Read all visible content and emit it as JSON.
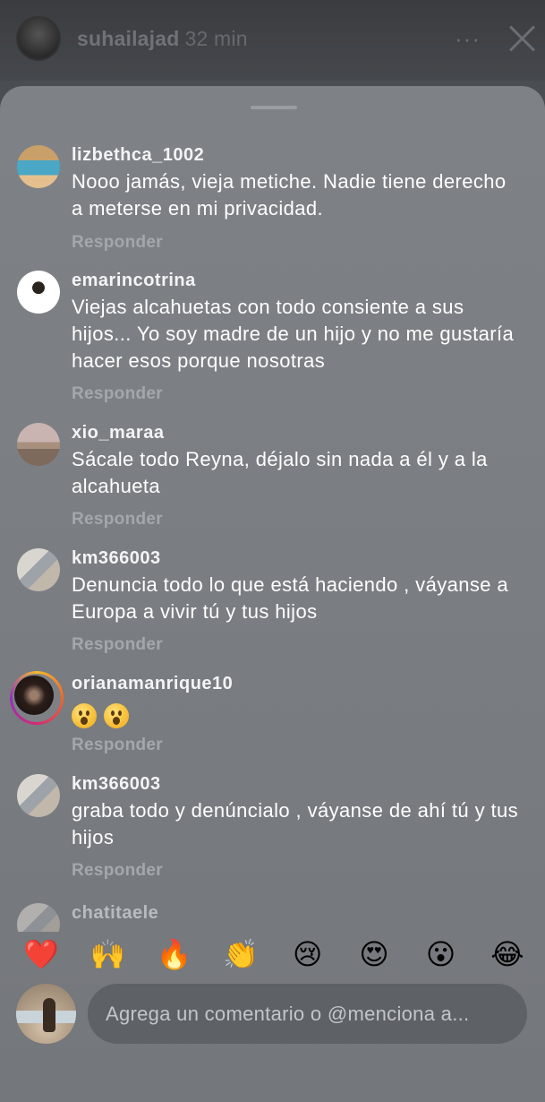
{
  "story": {
    "username": "suhailajad",
    "time": "32 min",
    "more_label": "···"
  },
  "comments": [
    {
      "username": "lizbethca_1002",
      "text": "Nooo jamás,  vieja metiche. Nadie tiene derecho a meterse en mi privacidad.",
      "reply": "Responder"
    },
    {
      "username": "emarincotrina",
      "text": "Viejas alcahuetas con todo consiente a sus hijos... Yo soy madre de un hijo y no me gustaría hacer esos porque nosotras",
      "reply": "Responder"
    },
    {
      "username": "xio_maraa",
      "text": "Sácale todo Reyna, déjalo sin nada a él y a la alcahueta",
      "reply": "Responder"
    },
    {
      "username": "km366003",
      "text": "Denuncia todo lo que está haciendo , váyanse a Europa a vivir tú y tus hijos",
      "reply": "Responder"
    },
    {
      "username": "orianamanrique10",
      "text": "",
      "reply": "Responder"
    },
    {
      "username": "km366003",
      "text": "graba todo y denúncialo , váyanse de ahí tú y tus hijos",
      "reply": "Responder"
    },
    {
      "username": "chatitaele"
    }
  ],
  "reactions": [
    "❤️",
    "🙌",
    "🔥",
    "👏",
    "😢",
    "😍",
    "😮",
    "😂"
  ],
  "input": {
    "placeholder": "Agrega un comentario o @menciona a..."
  }
}
